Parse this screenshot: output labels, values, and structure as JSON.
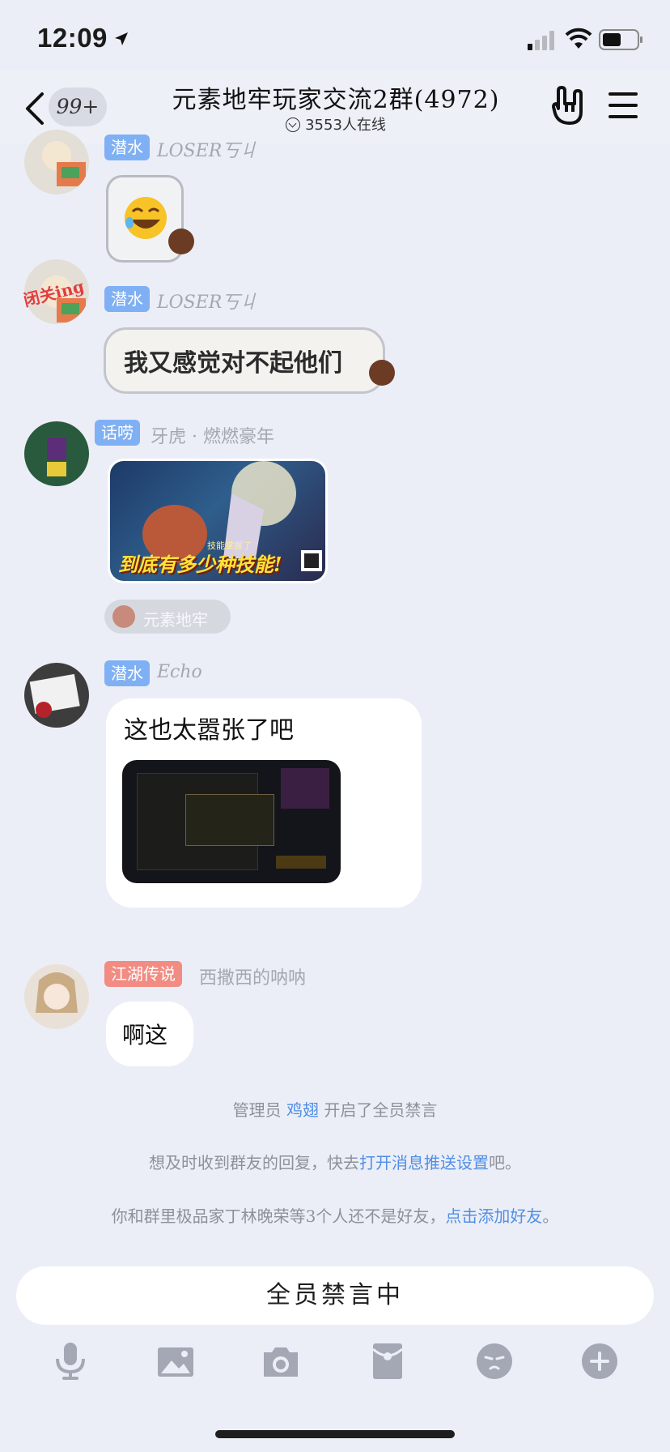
{
  "status_bar": {
    "time": "12:09"
  },
  "header": {
    "unread_count": "99+",
    "title": "元素地牢玩家交流2群(4972)",
    "online": "3553人在线"
  },
  "messages": [
    {
      "tag": "潜水",
      "nick": "LOSER丂丩",
      "type": "sticker",
      "sticker_icon": "laughing-tears-emoji"
    },
    {
      "tag": "潜水",
      "nick": "LOSER丂丩",
      "type": "text",
      "text": "我又感觉对不起他们",
      "avatar_badge": "闭关ing"
    },
    {
      "tag": "话唠",
      "nick": "牙虎 · 燃燃豪年",
      "type": "image",
      "image_caption": "到底有多少种技能!",
      "image_subcaption": "技能掌握了",
      "mention_chip": "元素地牢"
    },
    {
      "tag": "潜水",
      "nick": "Echo",
      "type": "text_image",
      "text": "这也太嚣张了吧"
    },
    {
      "tag": "江湖传说",
      "nick": "西撒西的呐呐",
      "type": "text",
      "text": "啊这"
    }
  ],
  "system": {
    "mute_notice": {
      "prefix": "管理员 ",
      "admin": "鸡翅",
      "suffix": " 开启了全员禁言"
    },
    "push_notice": {
      "prefix": "想及时收到群友的回复，快去",
      "link": "打开消息推送设置",
      "suffix": "吧。"
    },
    "friend_notice": {
      "prefix": "你和群里极品家丁林晚荣等3个人还不是好友，",
      "link": "点击添加好友",
      "suffix": "。"
    }
  },
  "input": {
    "muted_label": "全员禁言中"
  },
  "toolbar": [
    "microphone-icon",
    "image-icon",
    "camera-icon",
    "red-packet-icon",
    "emoji-icon",
    "plus-icon"
  ],
  "colors": {
    "background": "#eceef7",
    "tag_blue": "#7fb0f4",
    "tag_red": "#f28b82",
    "link": "#4f8fe6",
    "toolbar_icon": "#a4a7b4"
  }
}
